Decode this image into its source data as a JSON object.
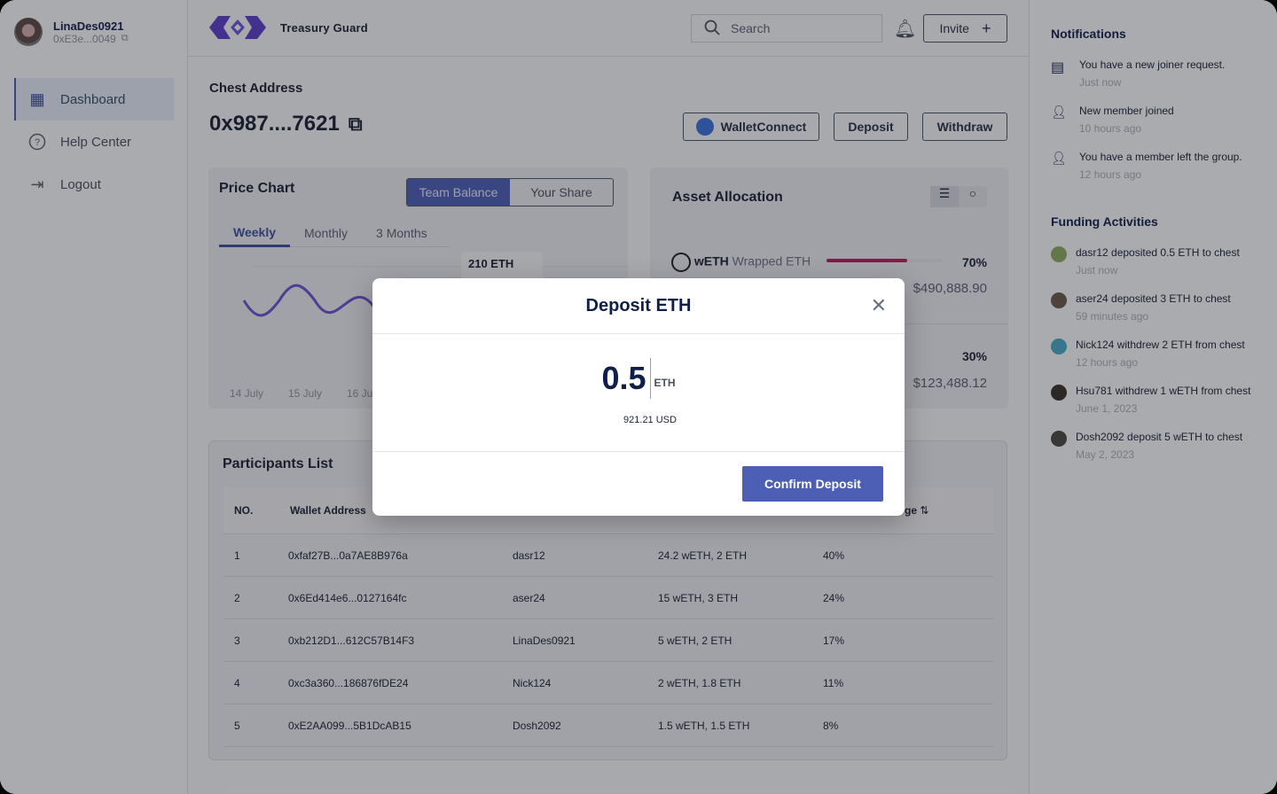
{
  "user": {
    "name": "LinaDes0921",
    "address": "0xE3e...0049"
  },
  "nav": [
    {
      "label": "Dashboard",
      "icon": "dashboard-icon",
      "active": true
    },
    {
      "label": "Help Center",
      "icon": "help-icon"
    },
    {
      "label": "Logout",
      "icon": "logout-icon"
    }
  ],
  "header": {
    "brand": "Treasury Guard",
    "search_placeholder": "Search",
    "invite_label": "Invite"
  },
  "chest": {
    "label": "Chest Address",
    "address": "0x987....7621"
  },
  "actions": {
    "walletconnect": "WalletConnect",
    "deposit": "Deposit",
    "withdraw": "Withdraw"
  },
  "price_chart": {
    "title": "Price Chart",
    "toggle": [
      "Team Balance",
      "Your Share"
    ],
    "tabs": [
      "Weekly",
      "Monthly",
      "3 Months"
    ],
    "tooltip": "210 ETH",
    "x_labels": [
      "14 July",
      "15 July",
      "16 Ju"
    ]
  },
  "asset_allocation": {
    "title": "Asset Allocation",
    "assets": [
      {
        "symbol": "wETH",
        "name": "Wrapped ETH",
        "percent": "70%",
        "fill": 0.7,
        "value": "$490,888.90",
        "color": "#c2185b"
      },
      {
        "percent": "30%",
        "value": "$123,488.12"
      }
    ]
  },
  "participants": {
    "title": "Participants List",
    "headers": [
      "NO.",
      "Wallet Address",
      "ge"
    ],
    "rows": [
      [
        "1",
        "0xfaf27B...0a7AE8B976a",
        "dasr12",
        "24.2 wETH, 2 ETH",
        "40%"
      ],
      [
        "2",
        "0x6Ed414e6...0127164fc",
        "aser24",
        "15 wETH, 3 ETH",
        "24%"
      ],
      [
        "3",
        "0xb212D1...612C57B14F3",
        "LinaDes0921",
        "5 wETH, 2 ETH",
        "17%"
      ],
      [
        "4",
        "0xc3a360...186876fDE24",
        "Nick124",
        "2 wETH, 1.8 ETH",
        "11%"
      ],
      [
        "5",
        "0xE2AA099...5B1DcAB15",
        "Dosh2092",
        "1.5 wETH, 1.5 ETH",
        "8%"
      ]
    ]
  },
  "notifications": {
    "title": "Notifications",
    "items": [
      {
        "text": "You have a new joiner request.",
        "time": "Just now",
        "icon": "message-icon"
      },
      {
        "text": "New member joined",
        "time": "10 hours ago",
        "icon": "person-icon"
      },
      {
        "text": "You have a member left the group.",
        "time": "12 hours ago",
        "icon": "person-remove-icon"
      }
    ]
  },
  "funding": {
    "title": "Funding Activities",
    "items": [
      {
        "text": "dasr12 deposited 0.5 ETH to chest",
        "time": "Just now"
      },
      {
        "text": "aser24 deposited 3 ETH to chest",
        "time": "59 minutes ago"
      },
      {
        "text": "Nick124 withdrew 2 ETH from chest",
        "time": "12 hours ago"
      },
      {
        "text": "Hsu781 withdrew 1 wETH from chest",
        "time": "June 1, 2023"
      },
      {
        "text": "Dosh2092 deposit 5 wETH to chest",
        "time": "May 2, 2023"
      }
    ]
  },
  "modal": {
    "title": "Deposit ETH",
    "amount": "0.5",
    "unit": "ETH",
    "usd": "921.21 USD",
    "confirm": "Confirm Deposit"
  }
}
